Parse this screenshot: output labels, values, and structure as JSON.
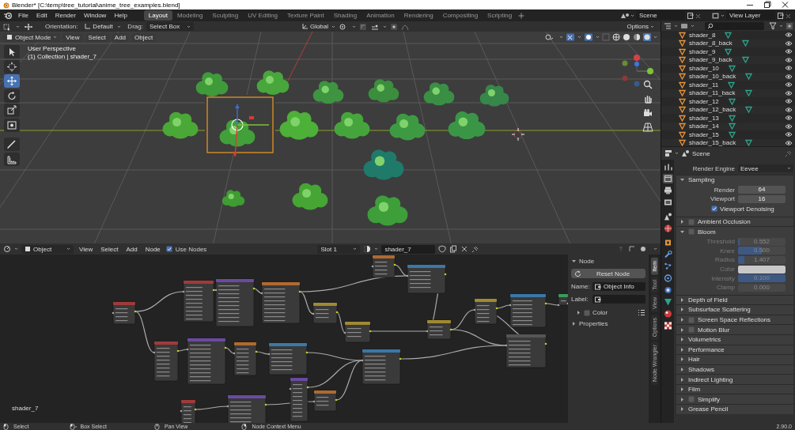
{
  "window": {
    "title": "Blender* [C:\\temp\\tree_tutorial\\anime_tree_examples.blend]"
  },
  "topbar": {
    "menus": [
      "File",
      "Edit",
      "Render",
      "Window",
      "Help"
    ],
    "workspaces": [
      {
        "label": "Layout",
        "selected": true
      },
      {
        "label": "Modeling",
        "selected": false
      },
      {
        "label": "Sculpting",
        "selected": false
      },
      {
        "label": "UV Editing",
        "selected": false
      },
      {
        "label": "Texture Paint",
        "selected": false
      },
      {
        "label": "Shading",
        "selected": false
      },
      {
        "label": "Animation",
        "selected": false
      },
      {
        "label": "Rendering",
        "selected": false
      },
      {
        "label": "Compositing",
        "selected": false
      },
      {
        "label": "Scripting",
        "selected": false
      }
    ],
    "scene": "Scene",
    "view_layer": "View Layer"
  },
  "viewport": {
    "orientation_label": "Orientation:",
    "orientation": "Default",
    "drag_label": "Drag:",
    "drag": "Select Box",
    "transform_orientation": "Global",
    "options": "Options",
    "mode": "Object Mode",
    "menus": [
      "View",
      "Select",
      "Add",
      "Object"
    ],
    "perspective": "User Perspective",
    "collection": "(1) Collection | shader_7",
    "tools": [
      {
        "kind": "select",
        "selected": false
      },
      {
        "kind": "cursor",
        "selected": false
      },
      {
        "kind": "move",
        "selected": true
      },
      {
        "kind": "rotate",
        "selected": false
      },
      {
        "kind": "scale",
        "selected": false
      },
      {
        "kind": "transform",
        "selected": false
      },
      {
        "kind": "annotate",
        "selected": false
      },
      {
        "kind": "measure",
        "selected": false
      }
    ]
  },
  "node_editor": {
    "type": "Object",
    "menus": [
      "View",
      "Select",
      "Add",
      "Node"
    ],
    "use_nodes": {
      "label": "Use Nodes",
      "checked": true
    },
    "slot": "Slot 1",
    "material": "shader_7",
    "canvas_label": "shader_7",
    "sidebar": {
      "panel": "Node",
      "expanded": true,
      "reset": "Reset Node",
      "name_label": "Name:",
      "name": "Object Info",
      "label_label": "Label:",
      "color": {
        "label": "Color",
        "checked": false,
        "expanded": false
      },
      "properties": {
        "label": "Properties",
        "expanded": false
      },
      "tabs": [
        {
          "label": "Item",
          "selected": true
        },
        {
          "label": "Tool",
          "selected": false
        },
        {
          "label": "View",
          "selected": false
        },
        {
          "label": "Options",
          "selected": false
        },
        {
          "label": "Node Wrangler",
          "selected": false
        }
      ]
    }
  },
  "outliner": {
    "items": [
      {
        "name": "shader_8"
      },
      {
        "name": "shader_8_back"
      },
      {
        "name": "shader_9"
      },
      {
        "name": "shader_9_back"
      },
      {
        "name": "shader_10"
      },
      {
        "name": "shader_10_back"
      },
      {
        "name": "shader_11"
      },
      {
        "name": "shader_11_back"
      },
      {
        "name": "shader_12"
      },
      {
        "name": "shader_12_back"
      },
      {
        "name": "shader_13"
      },
      {
        "name": "shader_14"
      },
      {
        "name": "shader_15"
      },
      {
        "name": "shader_15_back"
      }
    ]
  },
  "properties": {
    "context": "Scene",
    "tabs": [
      {
        "kind": "tool",
        "selected": false
      },
      {
        "kind": "render",
        "selected": true
      },
      {
        "kind": "output",
        "selected": false
      },
      {
        "kind": "view_layer",
        "selected": false
      },
      {
        "kind": "scene",
        "selected": false
      },
      {
        "kind": "world",
        "selected": false
      },
      {
        "kind": "object",
        "selected": false
      },
      {
        "kind": "modifiers",
        "selected": false
      },
      {
        "kind": "particles",
        "selected": false
      },
      {
        "kind": "physics",
        "selected": false
      },
      {
        "kind": "constraints",
        "selected": false
      },
      {
        "kind": "data",
        "selected": false
      },
      {
        "kind": "material",
        "selected": false
      },
      {
        "kind": "texture",
        "selected": false
      }
    ],
    "render_engine_label": "Render Engine",
    "render_engine": "Eevee",
    "panels": [
      {
        "title": "Sampling",
        "expanded": true,
        "fields": [
          {
            "kind": "number",
            "label": "Render",
            "value": "64"
          },
          {
            "kind": "number",
            "label": "Viewport",
            "value": "16"
          },
          {
            "kind": "checkbox",
            "label": "Viewport Denoising",
            "checked": true
          }
        ]
      },
      {
        "title": "Ambient Occlusion",
        "expanded": false,
        "enabled": false
      },
      {
        "title": "Bloom",
        "expanded": true,
        "enabled": false,
        "fields": [
          {
            "kind": "slider",
            "label": "Threshold",
            "value": "0.552",
            "level": 0.03
          },
          {
            "kind": "slider",
            "label": "Knee",
            "value": "0.500",
            "level": 0.5
          },
          {
            "kind": "slider",
            "label": "Radius",
            "value": "1.407",
            "level": 0.14
          },
          {
            "kind": "color",
            "label": "Color",
            "color": "#c8c8c8"
          },
          {
            "kind": "slider",
            "label": "Intensity",
            "value": "0.100",
            "level": 1
          },
          {
            "kind": "slider",
            "label": "Clamp",
            "value": "0.000",
            "level": 0
          }
        ]
      },
      {
        "title": "Depth of Field",
        "expanded": false
      },
      {
        "title": "Subsurface Scattering",
        "expanded": false
      },
      {
        "title": "Screen Space Reflections",
        "expanded": false,
        "enabled": false
      },
      {
        "title": "Motion Blur",
        "expanded": false,
        "enabled": false
      },
      {
        "title": "Volumetrics",
        "expanded": false
      },
      {
        "title": "Performance",
        "expanded": false
      },
      {
        "title": "Hair",
        "expanded": false
      },
      {
        "title": "Shadows",
        "expanded": false
      },
      {
        "title": "Indirect Lighting",
        "expanded": false
      },
      {
        "title": "Film",
        "expanded": false
      },
      {
        "title": "Simplify",
        "expanded": false,
        "enabled": false
      },
      {
        "title": "Grease Pencil",
        "expanded": false
      }
    ]
  },
  "status_bar": {
    "items": [
      {
        "kind": "left",
        "label": "Select"
      },
      {
        "kind": "drag",
        "label": "Box Select"
      },
      {
        "kind": "middle",
        "label": "Pan View"
      },
      {
        "kind": "right",
        "label": "Node Context Menu"
      }
    ],
    "version": "2.90.0"
  }
}
